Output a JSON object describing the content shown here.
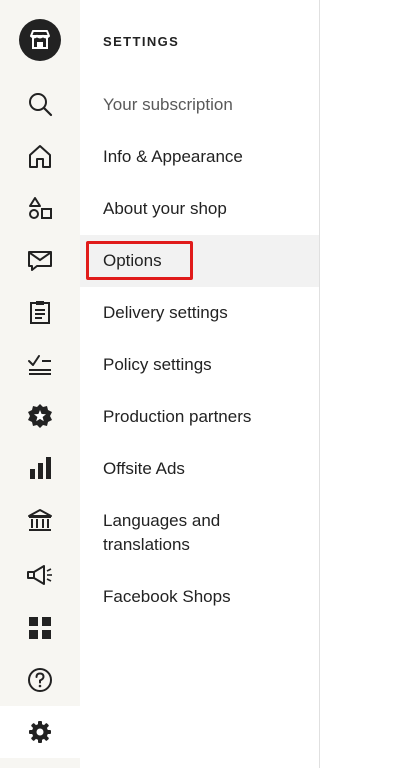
{
  "rail": {
    "items": [
      {
        "icon": "shop-logo-icon"
      },
      {
        "icon": "search-icon"
      },
      {
        "icon": "home-icon"
      },
      {
        "icon": "shapes-listings-icon"
      },
      {
        "icon": "mail-icon"
      },
      {
        "icon": "clipboard-orders-icon"
      },
      {
        "icon": "checklist-icon"
      },
      {
        "icon": "star-badge-icon"
      },
      {
        "icon": "bar-chart-icon"
      },
      {
        "icon": "bank-icon"
      },
      {
        "icon": "megaphone-icon"
      },
      {
        "icon": "grid-icon"
      },
      {
        "icon": "help-icon"
      },
      {
        "icon": "settings-gear-icon",
        "active": true
      }
    ]
  },
  "settings_menu": {
    "heading": "SETTINGS",
    "items": [
      {
        "label": "Your subscription"
      },
      {
        "label": "Info & Appearance"
      },
      {
        "label": "About your shop"
      },
      {
        "label": "Options",
        "selected": true
      },
      {
        "label": "Delivery settings"
      },
      {
        "label": "Policy settings"
      },
      {
        "label": "Production partners"
      },
      {
        "label": "Offsite Ads"
      },
      {
        "label": "Languages and translations"
      },
      {
        "label": "Facebook Shops"
      }
    ]
  },
  "colors": {
    "rail_background": "#f7f6f2",
    "selected_item_background": "#f2f2f2",
    "highlight_border": "#e01b1b",
    "text": "#222222",
    "muted_text": "#595959"
  }
}
